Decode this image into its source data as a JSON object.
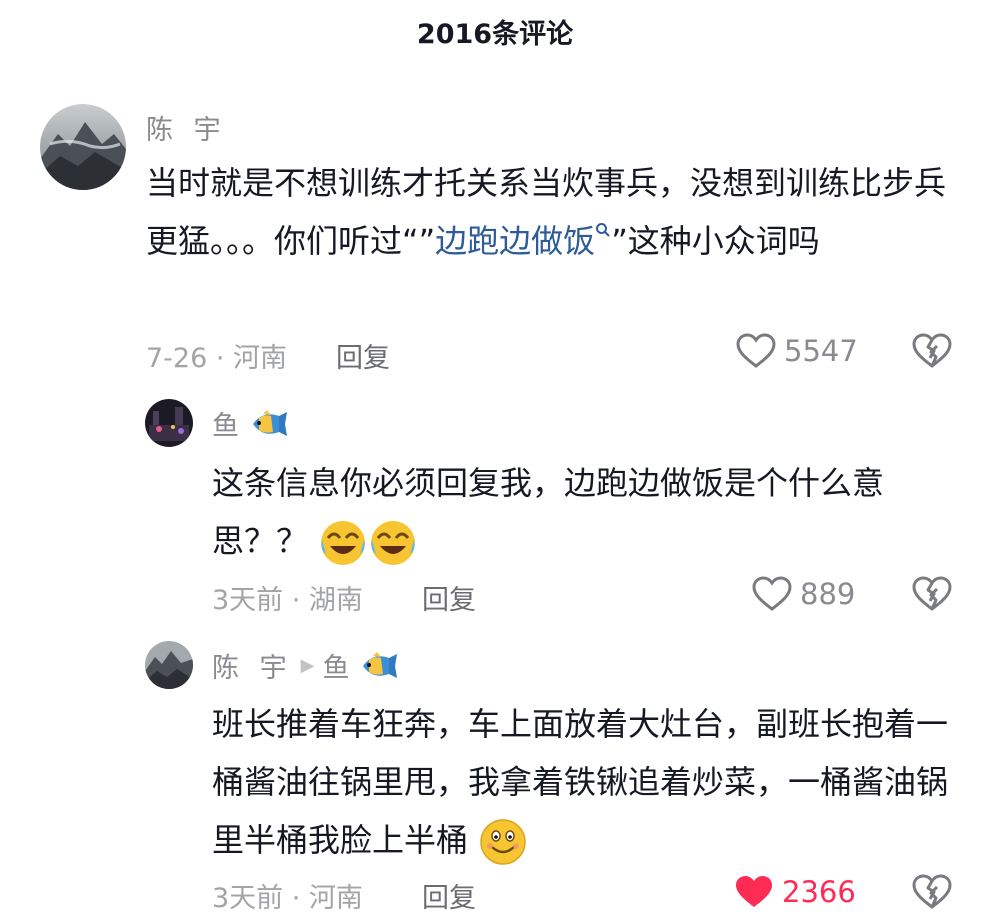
{
  "header": {
    "title": "2016条评论"
  },
  "comments": [
    {
      "user": "陈 宇",
      "text_before": "当时就是不想训练才托关系当炊事兵，没想到训练比步兵更猛。。。你们听过“”",
      "link": "边跑边做饭",
      "text_after": "”这种小众词吗",
      "meta": "7-26 · 河南",
      "reply": "回复",
      "likes": "5547",
      "liked": false
    },
    {
      "user": "鱼",
      "text": "这条信息你必须回复我，边跑边做饭是个什么意思？？",
      "meta": "3天前 · 湖南",
      "reply": "回复",
      "likes": "889",
      "liked": false
    },
    {
      "user": "陈 宇",
      "reply_to": "鱼",
      "text": "班长推着车狂奔，车上面放着大灶台，副班长抱着一桶酱油往锅里甩，我拿着铁锹追着炒菜，一桶酱油锅里半桶我脸上半桶",
      "meta": "3天前 · 河南",
      "reply": "回复",
      "likes": "2366",
      "liked": true
    }
  ],
  "colors": {
    "link": "#2d5c99",
    "like_active": "#fe2c55",
    "muted": "#8a8b91"
  }
}
